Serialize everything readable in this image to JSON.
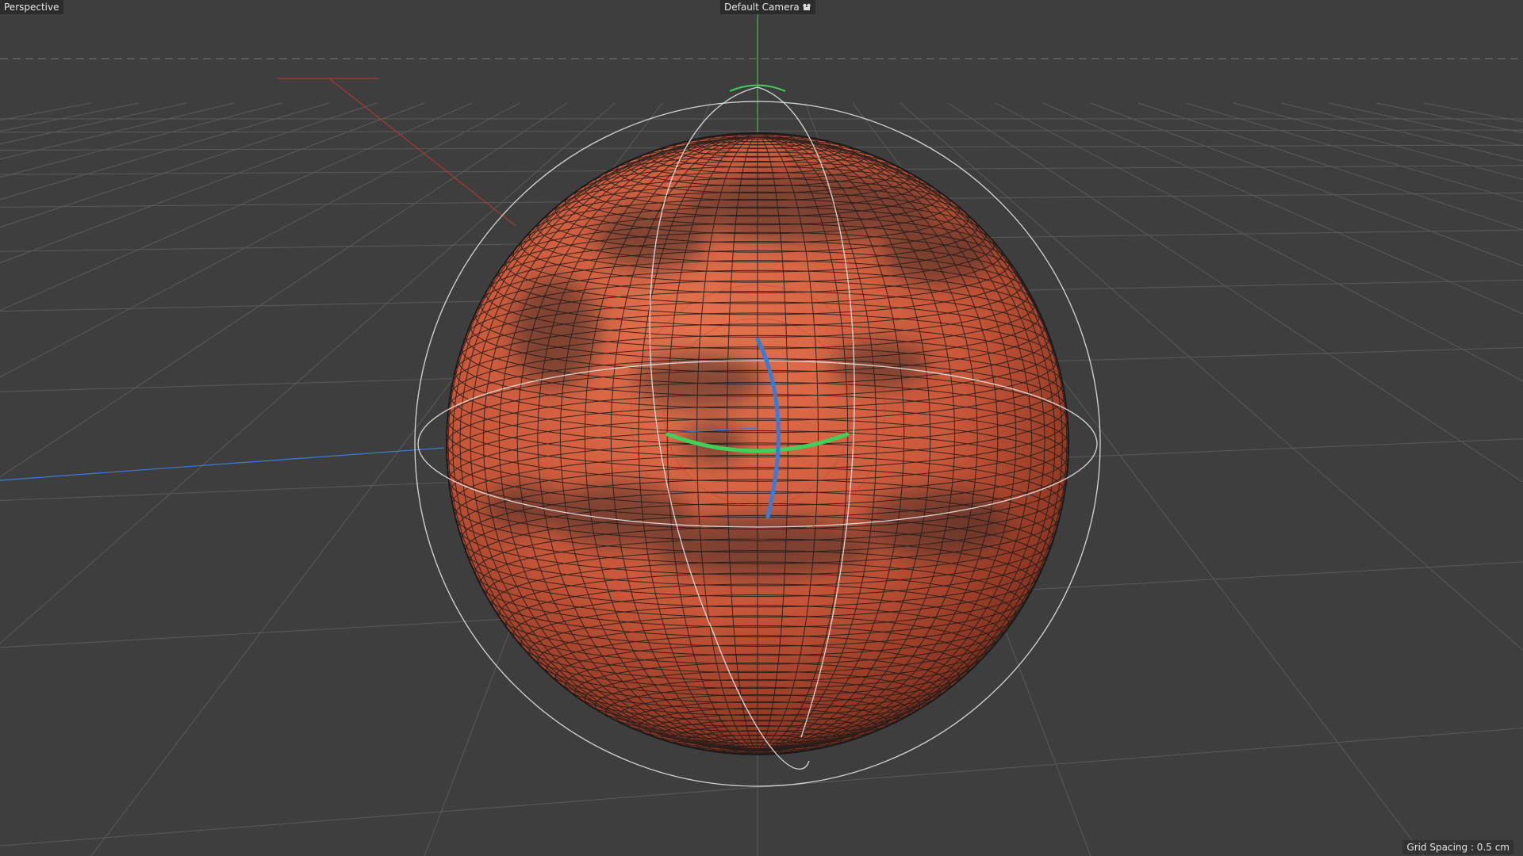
{
  "viewport": {
    "view_name": "Perspective",
    "camera_label": "Default Camera",
    "camera_icon": "camera-options-icon",
    "grid_spacing_text": "Grid Spacing : 0.5 cm"
  },
  "scene": {
    "object": "textured-sphere-mars",
    "background_color": "#3e3e3e",
    "grid_color": "#5a5a5a",
    "planet_color": "#c9573a",
    "wire_color": "#111111",
    "axis_colors": {
      "x": "#c0392b",
      "y": "#3fcf5a",
      "z": "#3b7bd8"
    },
    "rotation_guide_color": "#e8e8e8"
  }
}
